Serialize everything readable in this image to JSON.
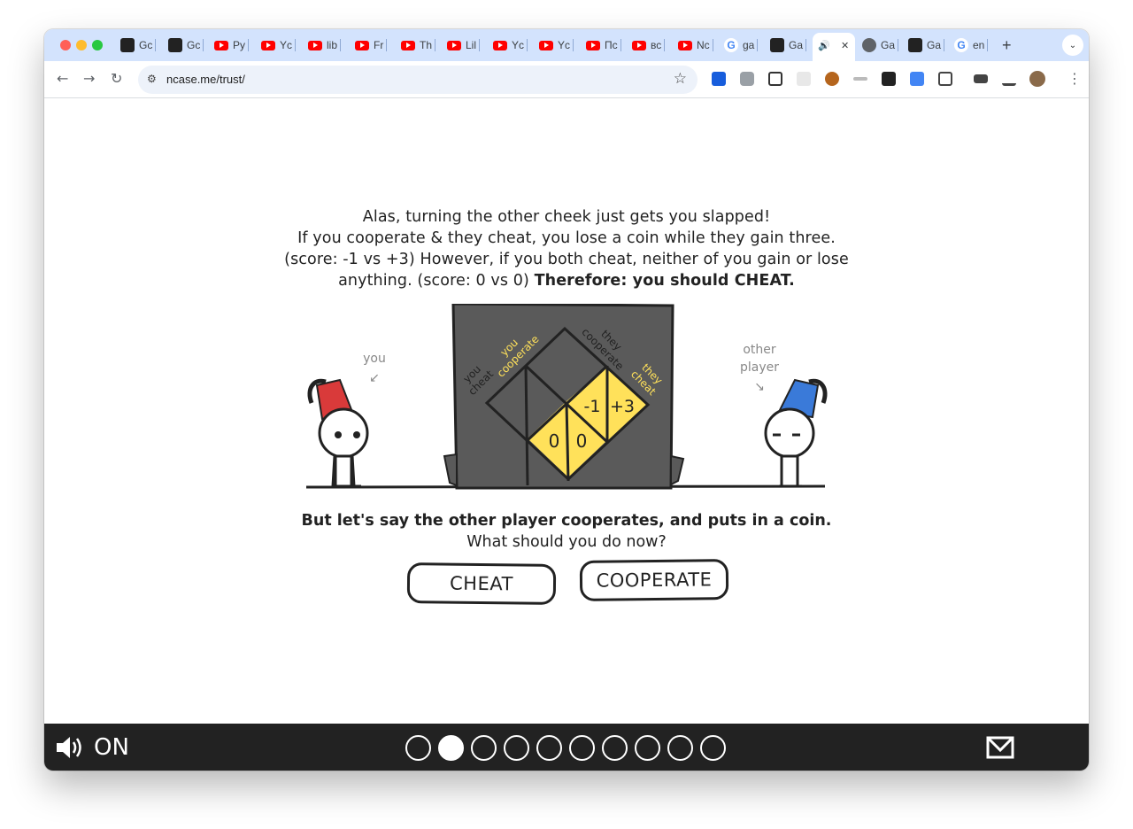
{
  "browser": {
    "tabs": [
      {
        "label": "Gc",
        "icon": "openai-icon"
      },
      {
        "label": "Gc",
        "icon": "code-icon"
      },
      {
        "label": "Py",
        "icon": "youtube-icon"
      },
      {
        "label": "Yc",
        "icon": "youtube-icon"
      },
      {
        "label": "lib",
        "icon": "youtube-icon"
      },
      {
        "label": "Fr",
        "icon": "youtube-icon"
      },
      {
        "label": "Th",
        "icon": "youtube-icon"
      },
      {
        "label": "Lil",
        "icon": "youtube-icon"
      },
      {
        "label": "Yc",
        "icon": "youtube-icon"
      },
      {
        "label": "Yc",
        "icon": "youtube-icon"
      },
      {
        "label": "Пс",
        "icon": "youtube-icon"
      },
      {
        "label": "вс",
        "icon": "youtube-icon"
      },
      {
        "label": "Nc",
        "icon": "youtube-icon"
      },
      {
        "label": "ga",
        "icon": "google-icon"
      },
      {
        "label": "Ga",
        "icon": "ga-icon"
      },
      {
        "label": "",
        "icon": "speaker-icon",
        "active": true
      },
      {
        "label": "Ga",
        "icon": "globe-icon"
      },
      {
        "label": "Ga",
        "icon": "translate-icon"
      },
      {
        "label": "en",
        "icon": "google-icon"
      }
    ],
    "new_tab": "+",
    "url": "ncase.me/trust/"
  },
  "content": {
    "paragraph_lines": [
      "Alas, turning the other cheek just gets you slapped!",
      "If you cooperate & they cheat, you lose a coin while they gain three.",
      "(score: -1 vs +3) However, if you both cheat, neither of you gain or lose",
      "anything. (score: 0 vs 0)"
    ],
    "paragraph_bold": "Therefore: you should CHEAT.",
    "question_bold": "But let's say the other player cooperates, and puts in a coin.",
    "question": "What should you do now?",
    "buttons": {
      "cheat": "CHEAT",
      "cooperate": "COOPERATE"
    },
    "illustration": {
      "you_label": "you",
      "other_label_1": "other",
      "other_label_2": "player",
      "you_cooperate": [
        "you",
        "cooperate"
      ],
      "you_cheat": [
        "you",
        "cheat"
      ],
      "they_cooperate": [
        "they",
        "cooperate"
      ],
      "they_cheat": [
        "they",
        "cheat"
      ],
      "cell_cheat_cheat": "0",
      "cell_cheat_cheat_2": "0",
      "cell_coop_cheat": "-1",
      "cell_coop_cheat_2": "+3"
    }
  },
  "footer": {
    "sound_label": "ON",
    "total_pages": 10,
    "current_page": 2
  },
  "colors": {
    "yellow": "#ffe15a",
    "machine": "#5a5a5a",
    "red_hat": "#d93a3a",
    "blue_hat": "#3a7ad9",
    "footer": "#222222"
  }
}
